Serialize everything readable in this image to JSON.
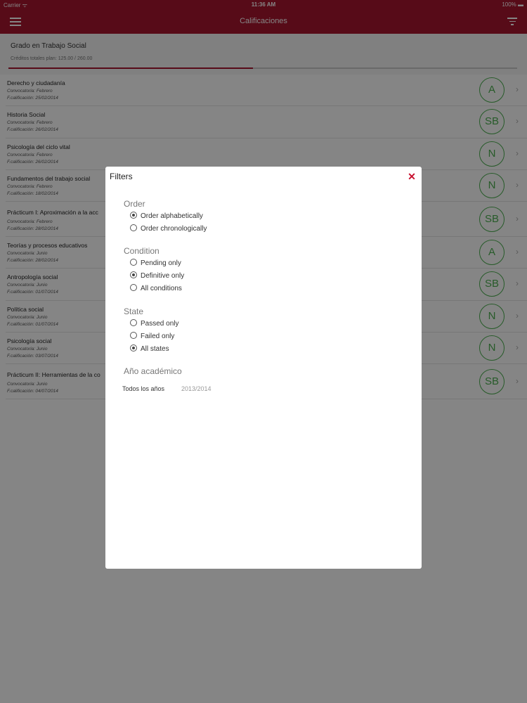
{
  "status_bar": {
    "carrier": "Carrier ᯤ",
    "time": "11:36 AM",
    "battery": "100% ▬"
  },
  "nav": {
    "title": "Calificaciones"
  },
  "degree": {
    "name": "Grado en Trabajo Social",
    "credits": "Créditos totales plan: 125.00 / 260.00",
    "progress": 0.48
  },
  "grades": [
    {
      "subject": "Derecho y ciudadanía",
      "convocatoria": "Convocatoria: Febrero",
      "fecha": "F.calificación: 25/02/2014",
      "grade": "A"
    },
    {
      "subject": "Historia Social",
      "convocatoria": "Convocatoria: Febrero",
      "fecha": "F.calificación: 26/02/2014",
      "grade": "SB"
    },
    {
      "subject": "Psicología del ciclo vital",
      "convocatoria": "Convocatoria: Febrero",
      "fecha": "F.calificación: 26/02/2014",
      "grade": "N"
    },
    {
      "subject": "Fundamentos del trabajo social",
      "convocatoria": "Convocatoria: Febrero",
      "fecha": "F.calificación: 18/02/2014",
      "grade": "N"
    },
    {
      "subject": "Prácticum I: Aproximación a la acc",
      "convocatoria": "Convocatoria: Febrero",
      "fecha": "F.calificación: 28/02/2014",
      "grade": "SB"
    },
    {
      "subject": "Teorías y procesos educativos",
      "convocatoria": "Convocatoria: Junio",
      "fecha": "F.calificación: 28/02/2014",
      "grade": "A"
    },
    {
      "subject": "Antropología social",
      "convocatoria": "Convocatoria: Junio",
      "fecha": "F.calificación: 01/07/2014",
      "grade": "SB"
    },
    {
      "subject": "Política social",
      "convocatoria": "Convocatoria: Junio",
      "fecha": "F.calificación: 01/07/2014",
      "grade": "N"
    },
    {
      "subject": "Psicología social",
      "convocatoria": "Convocatoria: Junio",
      "fecha": "F.calificación: 03/07/2014",
      "grade": "N"
    },
    {
      "subject": "Prácticum II: Herramientas de la co",
      "convocatoria": "Convocatoria: Junio",
      "fecha": "F.calificación: 04/07/2014",
      "grade": "SB"
    }
  ],
  "modal": {
    "title": "Filters",
    "order": {
      "label": "Order",
      "options": [
        "Order alphabetically",
        "Order chronologically"
      ],
      "selected": 0
    },
    "condition": {
      "label": "Condition",
      "options": [
        "Pending only",
        "Definitive only",
        "All conditions"
      ],
      "selected": 1
    },
    "state": {
      "label": "State",
      "options": [
        "Passed only",
        "Failed only",
        "All states"
      ],
      "selected": 2
    },
    "year": {
      "label": "Año académico",
      "all_label": "Todos los años",
      "value": "2013/2014"
    }
  },
  "colors": {
    "brand": "#a8162f",
    "grade_green": "#4caf50",
    "close_red": "#c8102e"
  },
  "icons": {
    "menu": "hamburger-icon",
    "filter": "filter-icon",
    "close": "close-icon",
    "chevron": "chevron-right-icon"
  }
}
